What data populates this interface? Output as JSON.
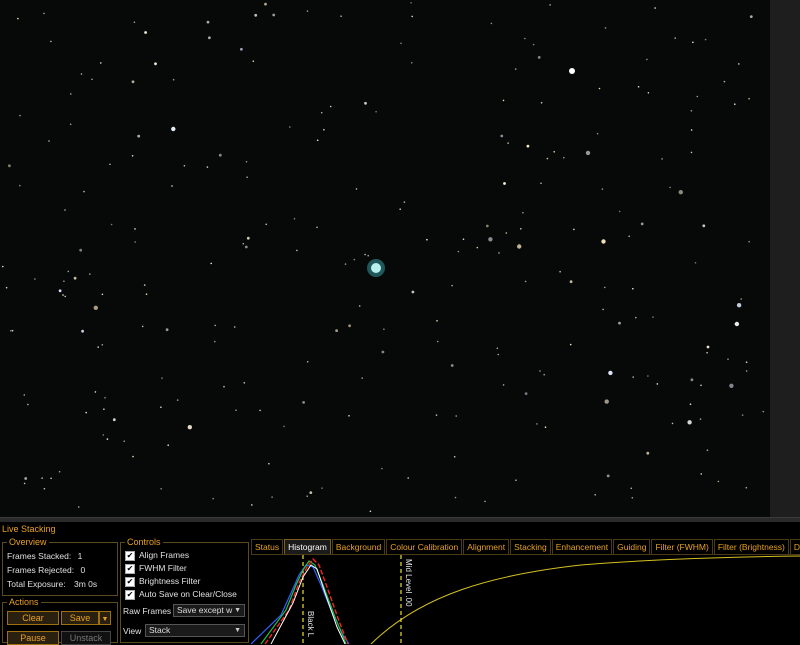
{
  "app": {
    "panel_title": "Live Stacking"
  },
  "colors": {
    "accent": "#e8a020",
    "background": "#000000"
  },
  "overview": {
    "title": "Overview",
    "frames_stacked_label": "Frames Stacked:",
    "frames_stacked_value": "1",
    "frames_rejected_label": "Frames Rejected:",
    "frames_rejected_value": "0",
    "total_exposure_label": "Total Exposure:",
    "total_exposure_value": "3m 0s"
  },
  "actions": {
    "title": "Actions",
    "clear": "Clear",
    "save": "Save",
    "pause": "Pause",
    "unstack": "Unstack"
  },
  "controls": {
    "title": "Controls",
    "align_frames": "Align Frames",
    "fwhm_filter": "FWHM Filter",
    "brightness_filter": "Brightness Filter",
    "auto_save": "Auto Save on Clear/Close",
    "raw_frames_label": "Raw Frames",
    "raw_frames_value": "Save except w",
    "view_label": "View",
    "view_value": "Stack"
  },
  "tabs": [
    "Status",
    "Histogram",
    "Background",
    "Colour Calibration",
    "Alignment",
    "Stacking",
    "Enhancement",
    "Guiding",
    "Filter (FWHM)",
    "Filter (Brightness)",
    "Drift"
  ],
  "active_tab": "Histogram",
  "histogram": {
    "black_level_label": "Black L",
    "mid_level_label": "Mid Level .00"
  }
}
